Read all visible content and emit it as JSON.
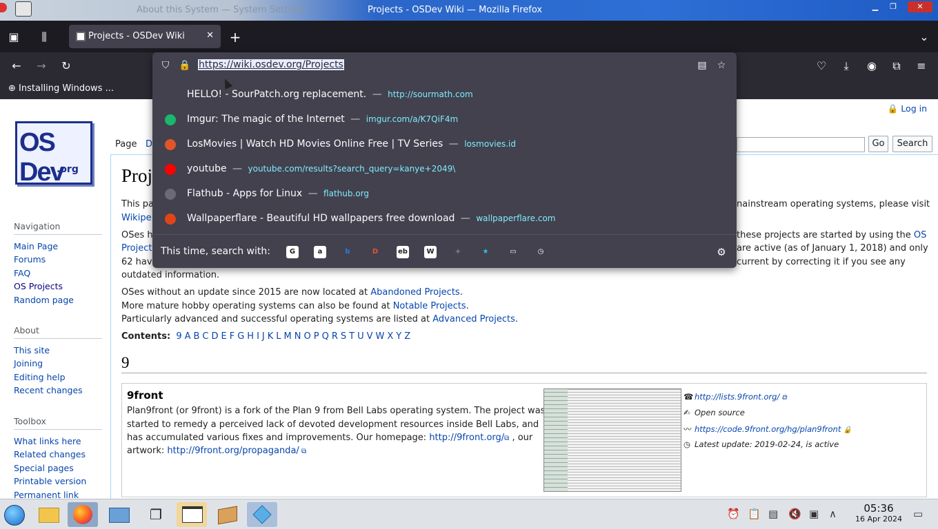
{
  "window": {
    "title": "Projects - OSDev Wiki — Mozilla Firefox",
    "ghost_title": "About this System — System Settings"
  },
  "tabs": [
    {
      "label": "Projects - OSDev Wiki",
      "close": "✕"
    }
  ],
  "new_tab": "+",
  "bookmarks": [
    {
      "label": "Installing Windows ..."
    }
  ],
  "urlbar": {
    "value": "https://wiki.osdev.org/Projects",
    "suggestions": [
      {
        "title": "HELLO! - SourPatch.org replacement.",
        "url": "http://sourmath.com",
        "color": "#42414d",
        "icon": "globe-icon"
      },
      {
        "title": "Imgur: The magic of the Internet",
        "url": "imgur.com/a/K7QiF4m",
        "color": "#1bb76e",
        "icon": "imgur-icon"
      },
      {
        "title": "LosMovies | Watch HD Movies Online Free | TV Series",
        "url": "losmovies.id",
        "color": "#e0562a",
        "icon": "losmovies-icon"
      },
      {
        "title": "youtube",
        "url": "youtube.com/results?search_query=kanye+2049\\",
        "color": "#ff0000",
        "icon": "youtube-icon"
      },
      {
        "title": "Flathub - Apps for Linux",
        "url": "flathub.org",
        "color": "#6b6b75",
        "icon": "flathub-icon"
      },
      {
        "title": "Wallpaperflare - Beautiful HD wallpapers free download",
        "url": "wallpaperflare.com",
        "color": "#e2441a",
        "icon": "wallpaperflare-icon"
      }
    ],
    "separator": "—",
    "search_with_label": "This time, search with:",
    "engines": [
      {
        "name": "google",
        "glyph": "G",
        "color": "#ffffff"
      },
      {
        "name": "amazon",
        "glyph": "a",
        "color": "#ffffff"
      },
      {
        "name": "bing",
        "glyph": "b",
        "color": "#2d7be5"
      },
      {
        "name": "duckduckgo",
        "glyph": "D",
        "color": "#de5833"
      },
      {
        "name": "ebay",
        "glyph": "eb",
        "color": "#ffffff"
      },
      {
        "name": "wikipedia",
        "glyph": "W",
        "color": "#ffffff"
      },
      {
        "name": "add-search",
        "glyph": "+",
        "color": "#8a8a95"
      },
      {
        "name": "bookmarks",
        "glyph": "★",
        "color": "#2ac3e8"
      },
      {
        "name": "tabs",
        "glyph": "▭",
        "color": "#fbfbfe"
      },
      {
        "name": "history",
        "glyph": "◷",
        "color": "#fbfbfe"
      }
    ]
  },
  "wiki": {
    "login": "Log in",
    "page_tab": "Page",
    "discussion_tab": "D",
    "search_go": "Go",
    "search_btn": "Search",
    "heading": "Proj",
    "nav": {
      "navigation_head": "Navigation",
      "navigation": [
        "Main Page",
        "Forums",
        "FAQ",
        "OS Projects",
        "Random page"
      ],
      "about_head": "About",
      "about": [
        "This site",
        "Joining",
        "Editing help",
        "Recent changes"
      ],
      "toolbox_head": "Toolbox",
      "toolbox": [
        "What links here",
        "Related changes",
        "Special pages",
        "Printable version",
        "Permanent link"
      ]
    },
    "intro_left_1": "This pa",
    "intro_left_1b": "Wikipe",
    "intro_right_1": "nainstream operating systems, please visit",
    "intro_left_2a": "OSes h",
    "intro_left_2b": "Project",
    "intro_left_2c": "62 hav",
    "intro_right_2a": "these projects are started by using the",
    "intro_right_2a_link": "OS",
    "intro_right_2b": "are active (as of January 1, 2018) and only",
    "intro_right_2c": "current by correcting it if you see any",
    "intro_line_4": "outdated information.",
    "abandoned_pre": "OSes without an update since 2015 are now located at ",
    "abandoned_link": "Abandoned Projects",
    "notable_pre": "More mature hobby operating systems can also be found at ",
    "notable_link": "Notable Projects",
    "advanced_pre": "Particularly advanced and successful operating systems are listed at ",
    "advanced_link": "Advanced Projects",
    "period": ".",
    "contents_label": "Contents:",
    "contents_links": [
      "9",
      "A",
      "B",
      "C",
      "D",
      "E",
      "F",
      "G",
      "H",
      "I",
      "J",
      "K",
      "L",
      "M",
      "N",
      "O",
      "P",
      "Q",
      "R",
      "S",
      "T",
      "U",
      "V",
      "W",
      "X",
      "Y",
      "Z"
    ],
    "section_9": "9",
    "project": {
      "name": "9front",
      "desc_1": "Plan9front (or 9front) is a fork of the Plan 9 from Bell Labs operating system. The project was",
      "desc_2": "started to remedy a perceived lack of devoted development resources inside Bell Labs, and",
      "desc_3_pre": "has accumulated various fixes and improvements. Our homepage: ",
      "desc_3_link": "http://9front.org/",
      "desc_3_post": " , our",
      "desc_4_pre": "artwork: ",
      "desc_4_link": "http://9front.org/propaganda/",
      "info_mailing": "http://lists.9front.org/",
      "info_license": "Open source",
      "info_repo": "https://code.9front.org/hg/plan9front",
      "info_update": "Latest update: 2019-02-24, is active"
    }
  },
  "taskbar": {
    "time": "05:36",
    "date": "16 Apr 2024"
  }
}
